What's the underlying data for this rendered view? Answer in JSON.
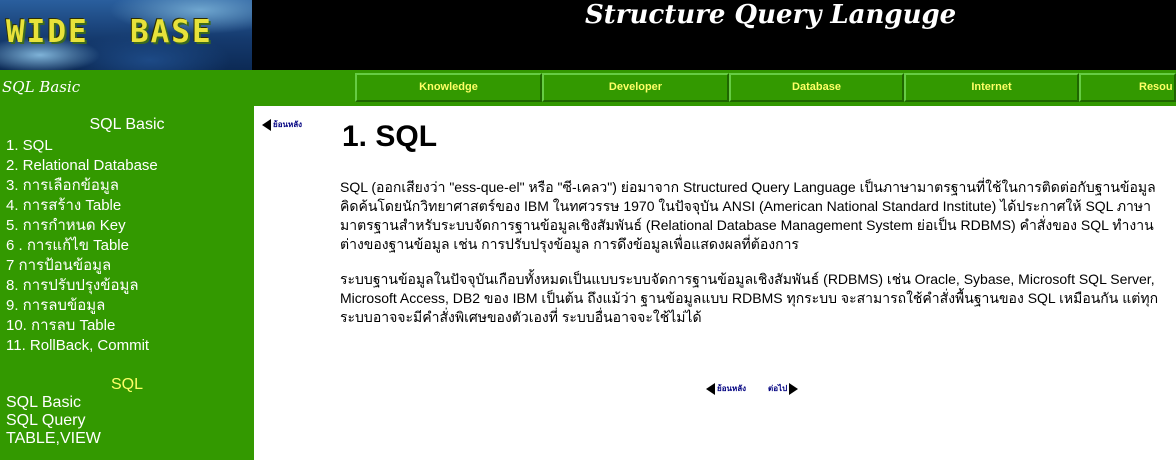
{
  "header": {
    "logo_text": "WIDE  BASE",
    "site_title": "Structure Query Languge"
  },
  "navbar": {
    "section_label": "SQL Basic",
    "tabs": [
      {
        "label": "Knowledge"
      },
      {
        "label": "Developer"
      },
      {
        "label": "Database"
      },
      {
        "label": "Internet"
      },
      {
        "label": "Resou"
      }
    ]
  },
  "sidebar": {
    "heading": "SQL Basic",
    "items": [
      {
        "label": "1. SQL"
      },
      {
        "label": "2. Relational Database"
      },
      {
        "label": "3. การเลือกข้อมูล"
      },
      {
        "label": "4. การสร้าง Table"
      },
      {
        "label": "5. การกำหนด Key"
      },
      {
        "label": "6 . การแก้ไข Table"
      },
      {
        "label": "7 การป้อนข้อมูล"
      },
      {
        "label": "8. การปรับปรุงข้อมูล"
      },
      {
        "label": "9. การลบข้อมูล"
      },
      {
        "label": "10. การลบ Table"
      },
      {
        "label": "11. RollBack, Commit"
      }
    ],
    "sql_heading": "SQL",
    "links": [
      {
        "label": "SQL Basic"
      },
      {
        "label": "SQL Query"
      },
      {
        "label": "TABLE,VIEW"
      }
    ]
  },
  "main": {
    "back_top_label": "ย้อนหลัง",
    "title": "1. SQL",
    "paragraphs": [
      "SQL (ออกเสียงว่า \"ess-que-el\" หรือ \"ซี-เคลว\") ย่อมาจาก Structured Query Language เป็นภาษามาตรฐานที่ใช้ในการติดต่อกับฐานข้อมูล คิดค้นโดยนักวิทยาศาสตร์ของ IBM ในทศวรรษ 1970 ในปัจจุบัน ANSI (American National Standard Institute) ได้ประกาศให้ SQL ภาษามาตรฐานสำหรับระบบจัดการฐานข้อมูลเชิงสัมพันธ์ (Relational Database Management System ย่อเป็น RDBMS) คำสั่งของ SQL ทำงานต่างของฐานข้อมูล เช่น การปรับปรุงข้อมูล การดึงข้อมูลเพื่อแสดงผลที่ต้องการ",
      "ระบบฐานข้อมูลในปัจจุบันเกือบทั้งหมดเป็นแบบระบบจัดการฐานข้อมูลเชิงสัมพันธ์ (RDBMS) เช่น Oracle, Sybase, Microsoft SQL Server, Microsoft Access, DB2 ของ IBM เป็นต้น ถึงแม้ว่า ฐานข้อมูลแบบ RDBMS ทุกระบบ จะสามารถใช้คำสั่งพื้นฐานของ SQL เหมือนกัน แต่ทุกระบบอาจจะมีคำสั่งพิเศษของตัวเองที่ ระบบอื่นอาจจะใช้ไม่ได้"
    ],
    "back_bottom_label": "ย้อนหลัง",
    "next_label": "ต่อไป"
  },
  "colors": {
    "green": "#339900",
    "header_bg": "#000000",
    "tab_text": "#ffff66"
  }
}
